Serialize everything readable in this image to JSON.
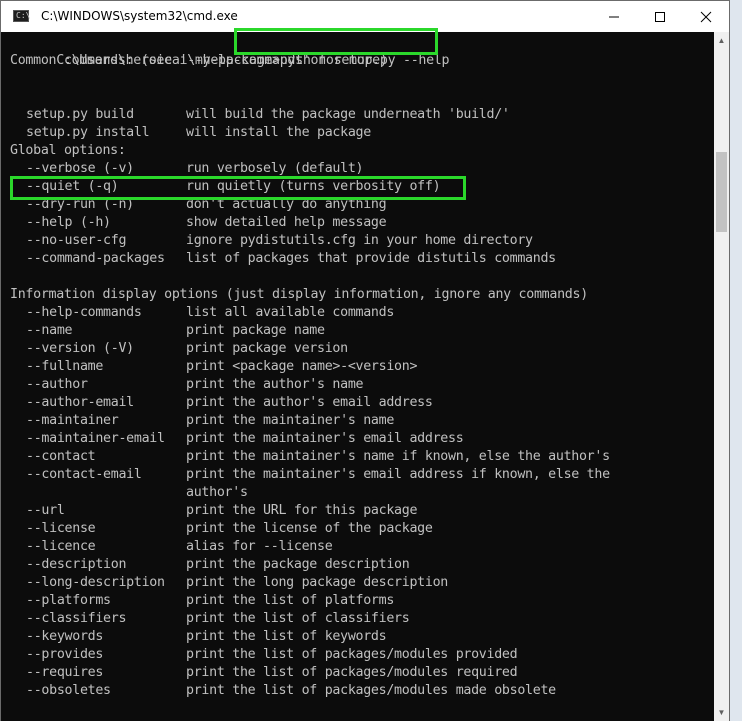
{
  "window": {
    "title": "C:\\WINDOWS\\system32\\cmd.exe",
    "minimize_glyph": "—",
    "maximize_glyph": "☐",
    "close_glyph": "✕"
  },
  "console": {
    "prompt": "C:\\Users\\heroicai\\my-package>",
    "command": "python setup.py --help",
    "common_header": "Common commands: (see '--help-commands' for more)",
    "common_commands": [
      {
        "opt": "setup.py build",
        "desc": "will build the package underneath 'build/'"
      },
      {
        "opt": "setup.py install",
        "desc": "will install the package"
      }
    ],
    "global_header": "Global options:",
    "global_options": [
      {
        "opt": "--verbose (-v)",
        "desc": "run verbosely (default)"
      },
      {
        "opt": "--quiet (-q)",
        "desc": "run quietly (turns verbosity off)"
      },
      {
        "opt": "--dry-run (-n)",
        "desc": "don't actually do anything"
      },
      {
        "opt": "--help (-h)",
        "desc": "show detailed help message"
      },
      {
        "opt": "--no-user-cfg",
        "desc": "ignore pydistutils.cfg in your home directory"
      },
      {
        "opt": "--command-packages",
        "desc": "list of packages that provide distutils commands"
      }
    ],
    "info_header": "Information display options (just display information, ignore any commands)",
    "info_options": [
      {
        "opt": "--help-commands",
        "desc": "list all available commands"
      },
      {
        "opt": "--name",
        "desc": "print package name"
      },
      {
        "opt": "--version (-V)",
        "desc": "print package version"
      },
      {
        "opt": "--fullname",
        "desc": "print <package name>-<version>"
      },
      {
        "opt": "--author",
        "desc": "print the author's name"
      },
      {
        "opt": "--author-email",
        "desc": "print the author's email address"
      },
      {
        "opt": "--maintainer",
        "desc": "print the maintainer's name"
      },
      {
        "opt": "--maintainer-email",
        "desc": "print the maintainer's email address"
      },
      {
        "opt": "--contact",
        "desc": "print the maintainer's name if known, else the author's"
      },
      {
        "opt": "--contact-email",
        "desc": "print the maintainer's email address if known, else the"
      },
      {
        "opt": "",
        "desc": "author's"
      },
      {
        "opt": "--url",
        "desc": "print the URL for this package"
      },
      {
        "opt": "--license",
        "desc": "print the license of the package"
      },
      {
        "opt": "--licence",
        "desc": "alias for --license"
      },
      {
        "opt": "--description",
        "desc": "print the package description"
      },
      {
        "opt": "--long-description",
        "desc": "print the long package description"
      },
      {
        "opt": "--platforms",
        "desc": "print the list of platforms"
      },
      {
        "opt": "--classifiers",
        "desc": "print the list of classifiers"
      },
      {
        "opt": "--keywords",
        "desc": "print the list of keywords"
      },
      {
        "opt": "--provides",
        "desc": "print the list of packages/modules provided"
      },
      {
        "opt": "--requires",
        "desc": "print the list of packages/modules required"
      },
      {
        "opt": "--obsoletes",
        "desc": "print the list of packages/modules made obsolete"
      }
    ]
  },
  "highlight_color": "#2bd82b",
  "text_color": "#c0c0c0",
  "background_color": "#0c0c0c"
}
